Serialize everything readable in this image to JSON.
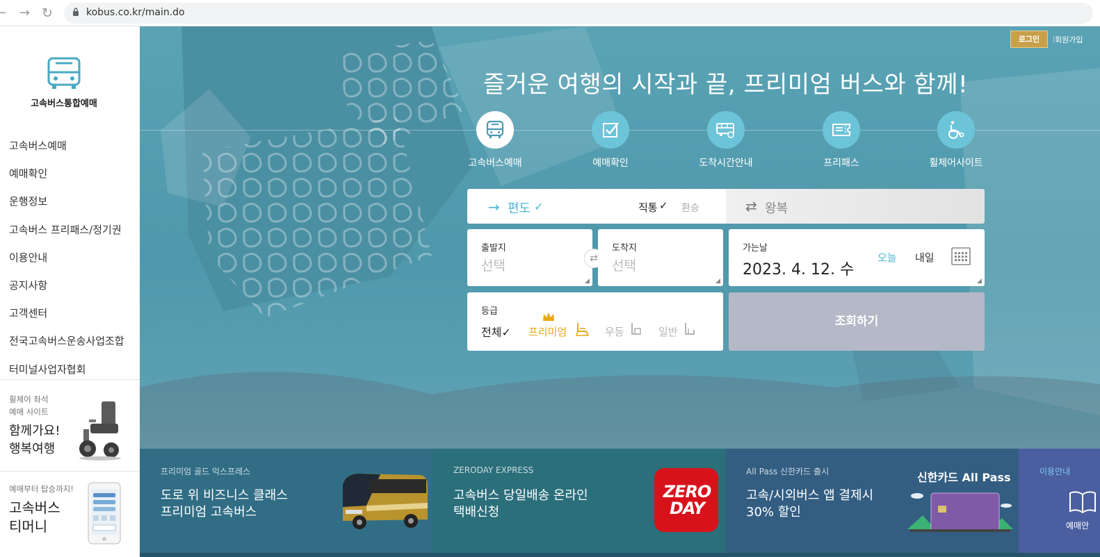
{
  "browser": {
    "url": "kobus.co.kr/main.do"
  },
  "sidebar": {
    "logo_text": "고속버스통합예매",
    "menu": [
      "고속버스예매",
      "예매확인",
      "운행정보",
      "고속버스 프리패스/정기권",
      "이용안내",
      "공지사항",
      "고객센터",
      "전국고속버스운송사업조합",
      "터미널사업자협회"
    ],
    "wheelchair_promo": {
      "line1": "휠체어 좌석",
      "line2": "예매 사이트",
      "title1": "함께가요!",
      "title2": "행복여행"
    },
    "tmoney_promo": {
      "small": "예매부터 탑승까지!",
      "title1": "고속버스",
      "title2": "티머니"
    }
  },
  "header": {
    "login_label": "로그인",
    "join_label": "회원가입"
  },
  "hero": {
    "headline": "즐거운 여행의 시작과 끝, 프리미엄 버스와 함께!",
    "menu": [
      {
        "label": "고속버스예매",
        "icon": "bus-icon",
        "active": true
      },
      {
        "label": "예매확인",
        "icon": "check-icon"
      },
      {
        "label": "도착시간안내",
        "icon": "arrival-bus-icon"
      },
      {
        "label": "프리패스",
        "icon": "ticket-icon"
      },
      {
        "label": "휠체어사이트",
        "icon": "wheelchair-icon"
      }
    ]
  },
  "form": {
    "oneway_label": "편도",
    "direct_label": "직통",
    "transfer_label": "환승",
    "roundtrip_label": "왕복",
    "departure_label": "출발지",
    "departure_placeholder": "선택",
    "arrival_label": "도착지",
    "arrival_placeholder": "선택",
    "date_label": "가는날",
    "date_value": "2023. 4. 12. 수",
    "today_label": "오늘",
    "tomorrow_label": "내일",
    "grade_label": "등급",
    "grade_all": "전체",
    "grade_premium": "프리미엄",
    "grade_superior": "우등",
    "grade_general": "일반",
    "search_label": "조회하기",
    "accent_color": "#4fb6d0",
    "premium_color": "#e7a812"
  },
  "banners": [
    {
      "small": "프리미엄 골드 익스프레스",
      "title1": "도로 위 비즈니스 클래스",
      "title2": "프리미엄 고속버스"
    },
    {
      "small": "ZERODAY EXPRESS",
      "title1": "고속버스 당일배송 온라인",
      "title2": "택배신청",
      "logo1": "ZERO",
      "logo2": "DAY"
    },
    {
      "small": "All Pass 신한카드 출시",
      "title1": "고속/시외버스 앱 결제시",
      "title2": "30% 할인",
      "card_title": "신한카드 All Pass"
    },
    {
      "small": "이용안내",
      "foot": "예매안"
    }
  ]
}
